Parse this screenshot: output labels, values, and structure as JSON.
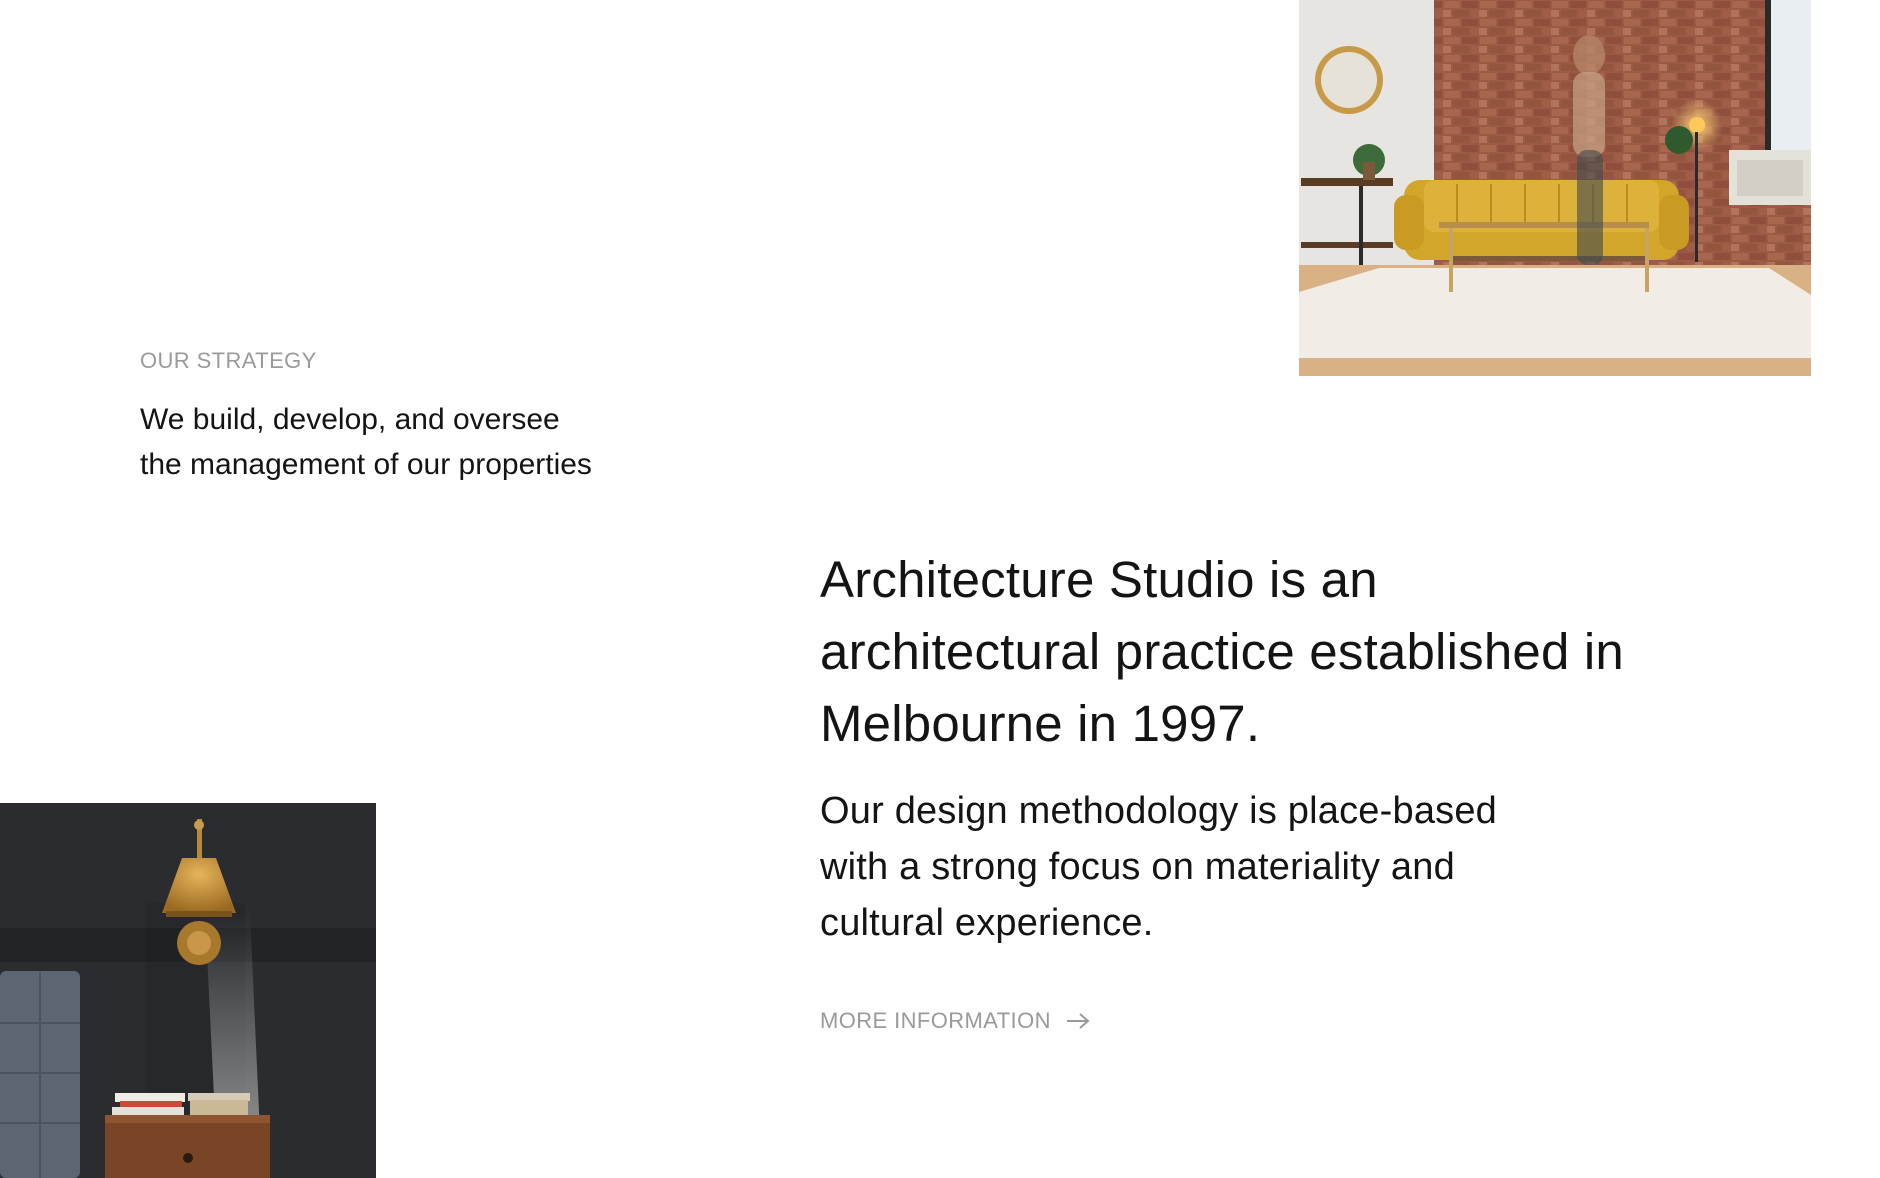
{
  "strategy": {
    "eyebrow": "OUR STRATEGY",
    "text_line1": "We build, develop, and oversee",
    "text_line2": "the management of our properties"
  },
  "about": {
    "headline_line1": "Architecture Studio is an",
    "headline_line2": "architectural practice established in",
    "headline_line3": "Melbourne in 1997.",
    "body_line1": "Our design methodology is place-based",
    "body_line2": "with a strong focus on materiality and",
    "body_line3": "cultural experience.",
    "more_label": "MORE INFORMATION"
  },
  "icons": {
    "more_arrow": "arrow-right-icon"
  },
  "colors": {
    "muted_text": "#9a9a9a",
    "body_text": "#141414",
    "sofa_mustard": "#d2a62a"
  }
}
